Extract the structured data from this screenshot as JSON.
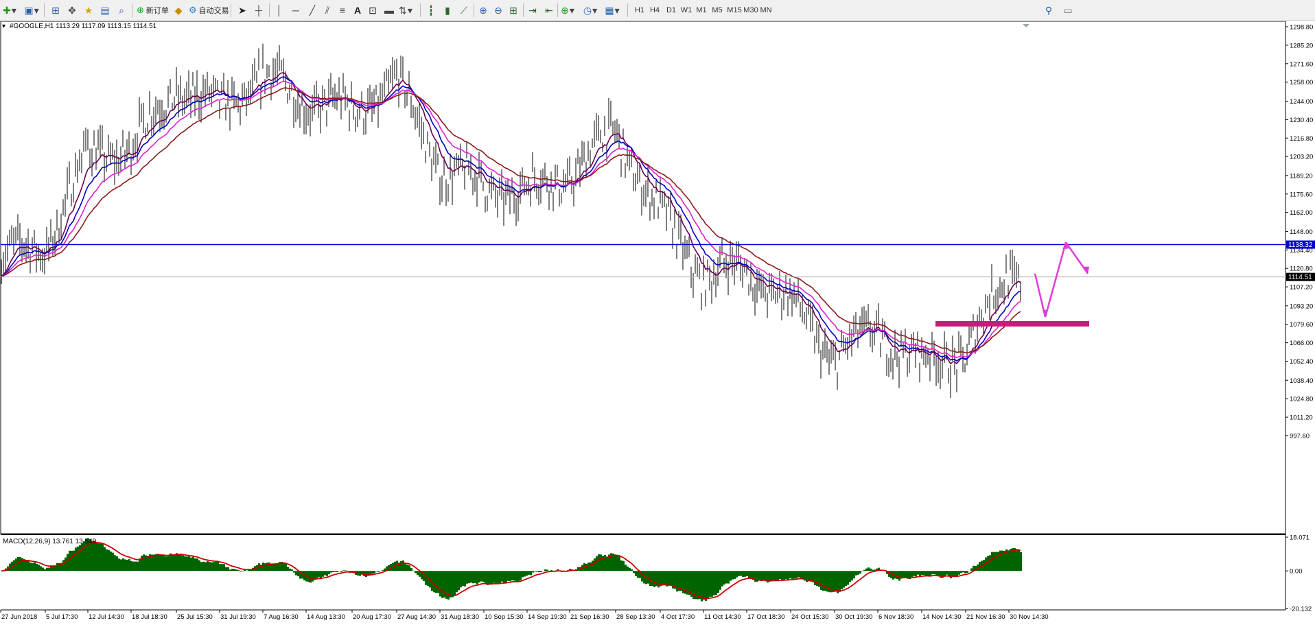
{
  "toolbar": {
    "new_order_label": "新订单",
    "auto_trade_label": "自动交易",
    "timeframes": [
      "H1",
      "H4",
      "D1",
      "W1",
      "M1",
      "M5",
      "M15",
      "M30",
      "MN"
    ],
    "icons": [
      "new-chart-icon",
      "profiles-icon",
      "market-watch-icon",
      "navigator-icon",
      "data-window-icon",
      "terminal-icon",
      "tester-icon",
      "new-order-icon",
      "metaeditor-icon",
      "auto-trading-icon",
      "cursor-icon",
      "crosshair-icon",
      "vertical-line-icon",
      "horizontal-line-icon",
      "trendline-icon",
      "equidistant-channel-icon",
      "fibonacci-icon",
      "text-icon",
      "text-label-icon",
      "rectangle-icon",
      "arrows-icon",
      "bar-chart-icon",
      "candlestick-icon",
      "line-chart-icon",
      "zoom-in-icon",
      "zoom-out-icon",
      "tile-windows-icon",
      "auto-scroll-icon",
      "chart-shift-icon",
      "indicators-icon",
      "periodicity-icon",
      "templates-icon",
      "search-icon",
      "chat-icon"
    ]
  },
  "chart": {
    "header": "#GOOGLE,H1  1113.29 1117.09 1113.15 1114.51",
    "macd_label": "MACD(12,26,9) 13.761 13.549",
    "price_axis": [
      "1298.80",
      "1285.20",
      "1271.60",
      "1258.00",
      "1244.00",
      "1230.40",
      "1216.80",
      "1203.20",
      "1189.20",
      "1175.60",
      "1162.00",
      "1148.00",
      "1134.40",
      "1120.80",
      "1107.20",
      "1093.20",
      "1079.60",
      "1066.00",
      "1052.40",
      "1038.40",
      "1024.80",
      "1011.20",
      "997.60"
    ],
    "macd_axis": [
      "18.071",
      "0.00",
      "-20.132"
    ],
    "time_axis": [
      "27 Jun 2018",
      "5 Jul 17:30",
      "12 Jul 14:30",
      "18 Jul 18:30",
      "25 Jul 15:30",
      "31 Jul 19:30",
      "7 Aug 16:30",
      "14 Aug 13:30",
      "20 Aug 17:30",
      "27 Aug 14:30",
      "31 Aug 18:30",
      "10 Sep 15:30",
      "14 Sep 19:30",
      "21 Sep 16:30",
      "28 Sep 13:30",
      "4 Oct 17:30",
      "11 Oct 14:30",
      "17 Oct 18:30",
      "24 Oct 15:30",
      "30 Oct 19:30",
      "6 Nov 18:30",
      "14 Nov 14:30",
      "21 Nov 16:30",
      "30 Nov 14:30"
    ],
    "hline_price_label": "1138.32",
    "current_price_label": "1114.51"
  },
  "chart_data": {
    "type": "line",
    "title": "#GOOGLE,H1",
    "ohlc_current": {
      "open": 1113.29,
      "high": 1117.09,
      "low": 1113.15,
      "close": 1114.51
    },
    "x": [
      "27 Jun 2018",
      "5 Jul",
      "12 Jul",
      "18 Jul",
      "25 Jul",
      "31 Jul",
      "7 Aug",
      "14 Aug",
      "20 Aug",
      "27 Aug",
      "31 Aug",
      "10 Sep",
      "14 Sep",
      "21 Sep",
      "28 Sep",
      "4 Oct",
      "11 Oct",
      "17 Oct",
      "24 Oct",
      "30 Oct",
      "6 Nov",
      "14 Nov",
      "21 Nov",
      "30 Nov"
    ],
    "series": [
      {
        "values": [
          1128,
          1138,
          1205,
          1210,
          1255,
          1238,
          1262,
          1245,
          1235,
          1258,
          1195,
          1180,
          1178,
          1190,
          1222,
          1160,
          1115,
          1120,
          1095,
          1055,
          1075,
          1050,
          1060,
          1118
        ]
      }
    ],
    "ylim": [
      997.6,
      1298.8
    ],
    "horizontal_line": 1138.32,
    "support_zone": [
      1078.0,
      1082.0
    ],
    "macd": {
      "value": 13.761,
      "signal": 13.549,
      "ylim": [
        -20.132,
        18.071
      ]
    },
    "colors": {
      "hline": "#0000cc",
      "zone": "#cc1a7a",
      "arrow": "#e23ad8",
      "bars": "#000000",
      "macd_hist": "#006400",
      "macd_signal": "#cc0000"
    }
  }
}
